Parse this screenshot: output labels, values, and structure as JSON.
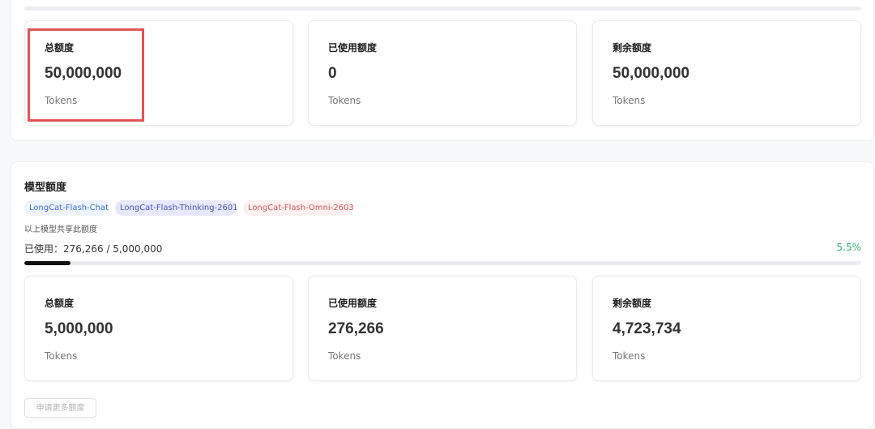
{
  "total_quota_section": {
    "cards": [
      {
        "label": "总额度",
        "value": "50,000,000",
        "unit": "Tokens"
      },
      {
        "label": "已使用额度",
        "value": "0",
        "unit": "Tokens"
      },
      {
        "label": "剩余额度",
        "value": "50,000,000",
        "unit": "Tokens"
      }
    ]
  },
  "model_quota_section": {
    "title": "模型额度",
    "tags": [
      "LongCat-Flash-Chat",
      "LongCat-Flash-Thinking-2601",
      "LongCat-Flash-Omni-2603"
    ],
    "shared_note": "以上模型共享此额度",
    "usage_text": "已使用：276,266 / 5,000,000",
    "usage_percent": "5.5%",
    "usage_fraction": 0.055,
    "cards": [
      {
        "label": "总额度",
        "value": "5,000,000",
        "unit": "Tokens"
      },
      {
        "label": "已使用额度",
        "value": "276,266",
        "unit": "Tokens"
      },
      {
        "label": "剩余额度",
        "value": "4,723,734",
        "unit": "Tokens"
      }
    ],
    "apply_button_label": "申请更多额度"
  },
  "colors": {
    "highlight": "#e25555",
    "percent": "#2eaf6a",
    "progress_fill": "#111111"
  }
}
